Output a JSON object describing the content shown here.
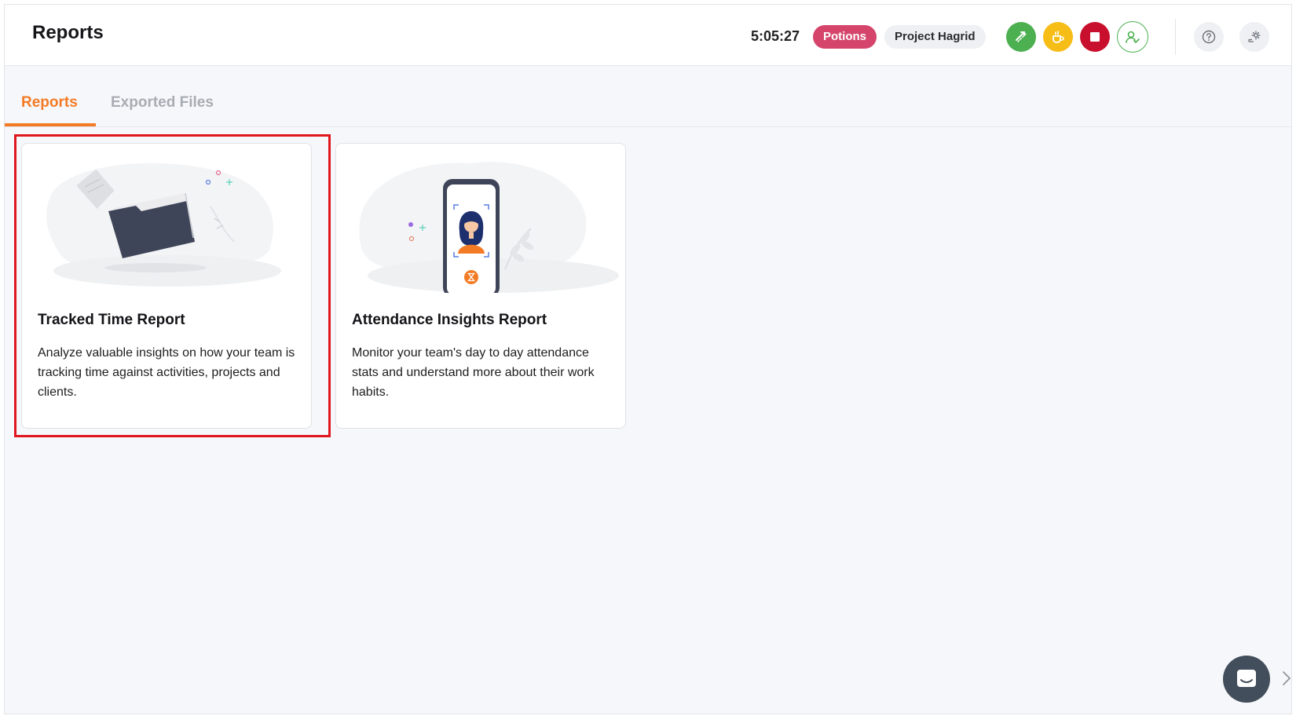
{
  "header": {
    "title": "Reports",
    "timer": "5:05:27",
    "activity_chip": "Potions",
    "project_chip": "Project Hagrid",
    "icons": [
      "transfer-icon",
      "coffee-break-icon",
      "stop-icon",
      "user-check-icon",
      "help-icon",
      "settings-icon"
    ],
    "colors": {
      "green": "#4caf50",
      "yellow": "#f6bd16",
      "red": "#c8102e",
      "chip_pink": "#d5456b"
    }
  },
  "tabs": [
    {
      "label": "Reports",
      "active": true
    },
    {
      "label": "Exported Files",
      "active": false
    }
  ],
  "accent_color": "#f47b25",
  "cards": [
    {
      "title": "Tracked Time Report",
      "description": "Analyze valuable insights on how your team is tracking time against activities, projects and clients.",
      "illustration": "folder-illustration",
      "highlighted": true
    },
    {
      "title": "Attendance Insights Report",
      "description": "Monitor your team's day to day attendance stats and understand more about their work habits.",
      "illustration": "phone-attendance-illustration",
      "highlighted": false
    }
  ],
  "chat_icon": "chat-icon",
  "nav_icon": "chevron-right-icon"
}
